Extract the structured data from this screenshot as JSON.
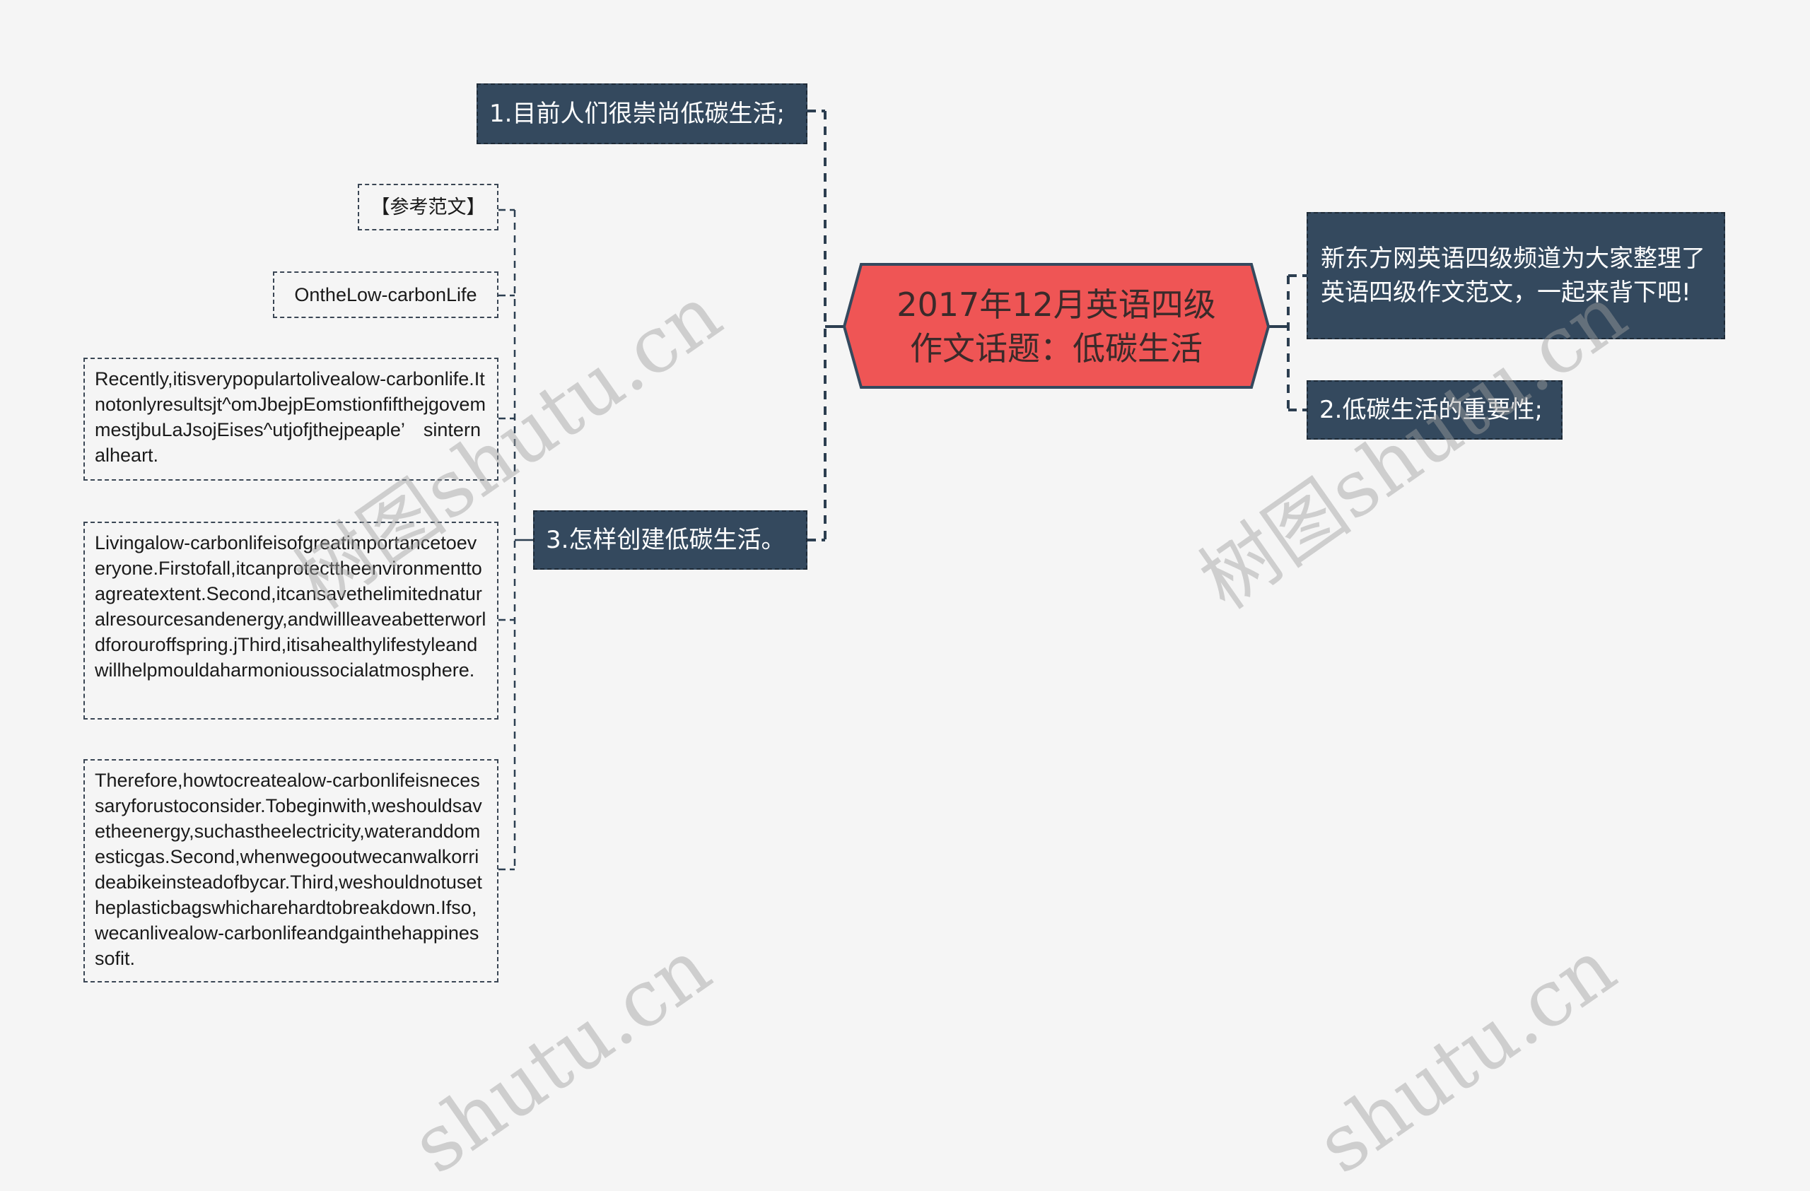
{
  "root": {
    "title": "2017年12月英语四级作文话题：低碳生活",
    "fill_color": "#ef5555",
    "border_color": "#34495e"
  },
  "left_branches": [
    {
      "label": "1.目前人们很崇尚低碳生活;"
    },
    {
      "label": "3.怎样创建低碳生活。"
    }
  ],
  "right_branches": [
    {
      "label": "新东方网英语四级频道为大家整理了英语四级作文范文，一起来背下吧!"
    },
    {
      "label": "2.低碳生活的重要性;"
    }
  ],
  "branch3_children": [
    {
      "label": "【参考范文】"
    },
    {
      "label": "OntheLow-carbonLife"
    },
    {
      "label": "Recently,itisverypopulartolivealow-carbonlife.Itnotonlyresultsjt^omJbejpEomstionfifthejgovemmestjbuLaJsojEises^utjofjthejpeaple’　sinternalheart."
    },
    {
      "label": "Livingalow-carbonlifeisofgreatimportancetoeveryone.Firstofall,itcanprotecttheenvironmenttoagreatextent.Second,itcansavethelimitednaturalresourcesandenergy,andwillleaveabetterworldforouroffspring.jThird,itisahealthylifestyleandwillhelpmouldaharmonioussocialatmosphere."
    },
    {
      "label": "Therefore,howtocreatealow-carbonlifeisnecessaryforustoconsider.Tobeginwith,weshouldsavetheenergy,suchastheelectricity,wateranddomesticgas.Second,whenwegooutwecanwalkorrideabikeinsteadofbycar.Third,weshouldnotusetheplasticbagswhicharehardtobreakdown.Ifso,wecanlivealow-carbonlifeandgainthehappinessofit."
    }
  ],
  "watermarks": [
    "树图shutu.cn",
    "树图shutu.cn",
    "shutu.cn",
    "shutu.cn"
  ],
  "colors": {
    "background": "#f5f5f5",
    "branch_fill": "#34495e",
    "branch_text": "#ffffff",
    "connector": "#2c3e50"
  }
}
